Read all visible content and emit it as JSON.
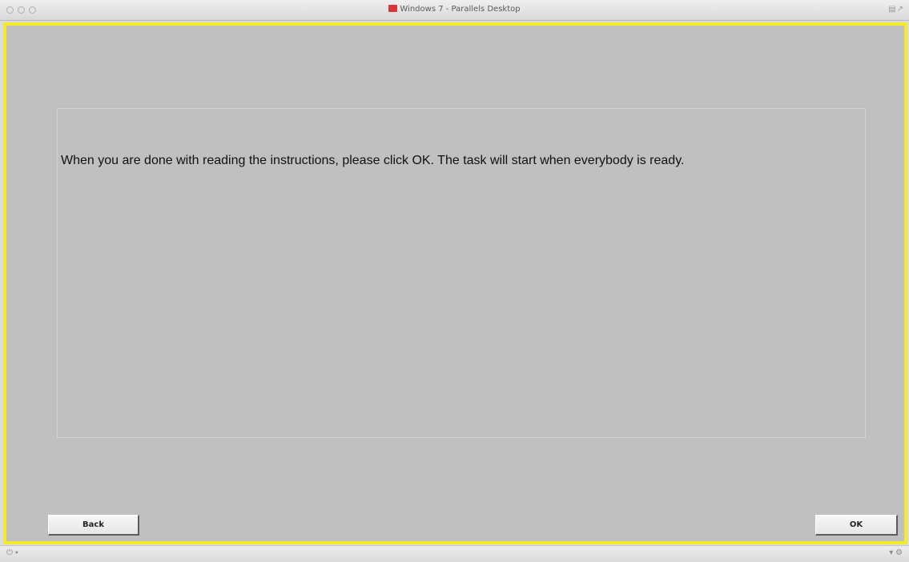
{
  "window": {
    "title": "Windows 7 - Parallels Desktop",
    "title_icon": "parallels-icon",
    "frame_color": "#f4ea2c"
  },
  "screen": {
    "instruction_text": "When you are done with reading the instructions, please click OK. The task will start when everybody is ready.",
    "buttons": {
      "back_label": "Back",
      "ok_label": "OK"
    }
  },
  "statusbar": {
    "left_icon": "power-icon",
    "right_icon": "settings-icon"
  }
}
